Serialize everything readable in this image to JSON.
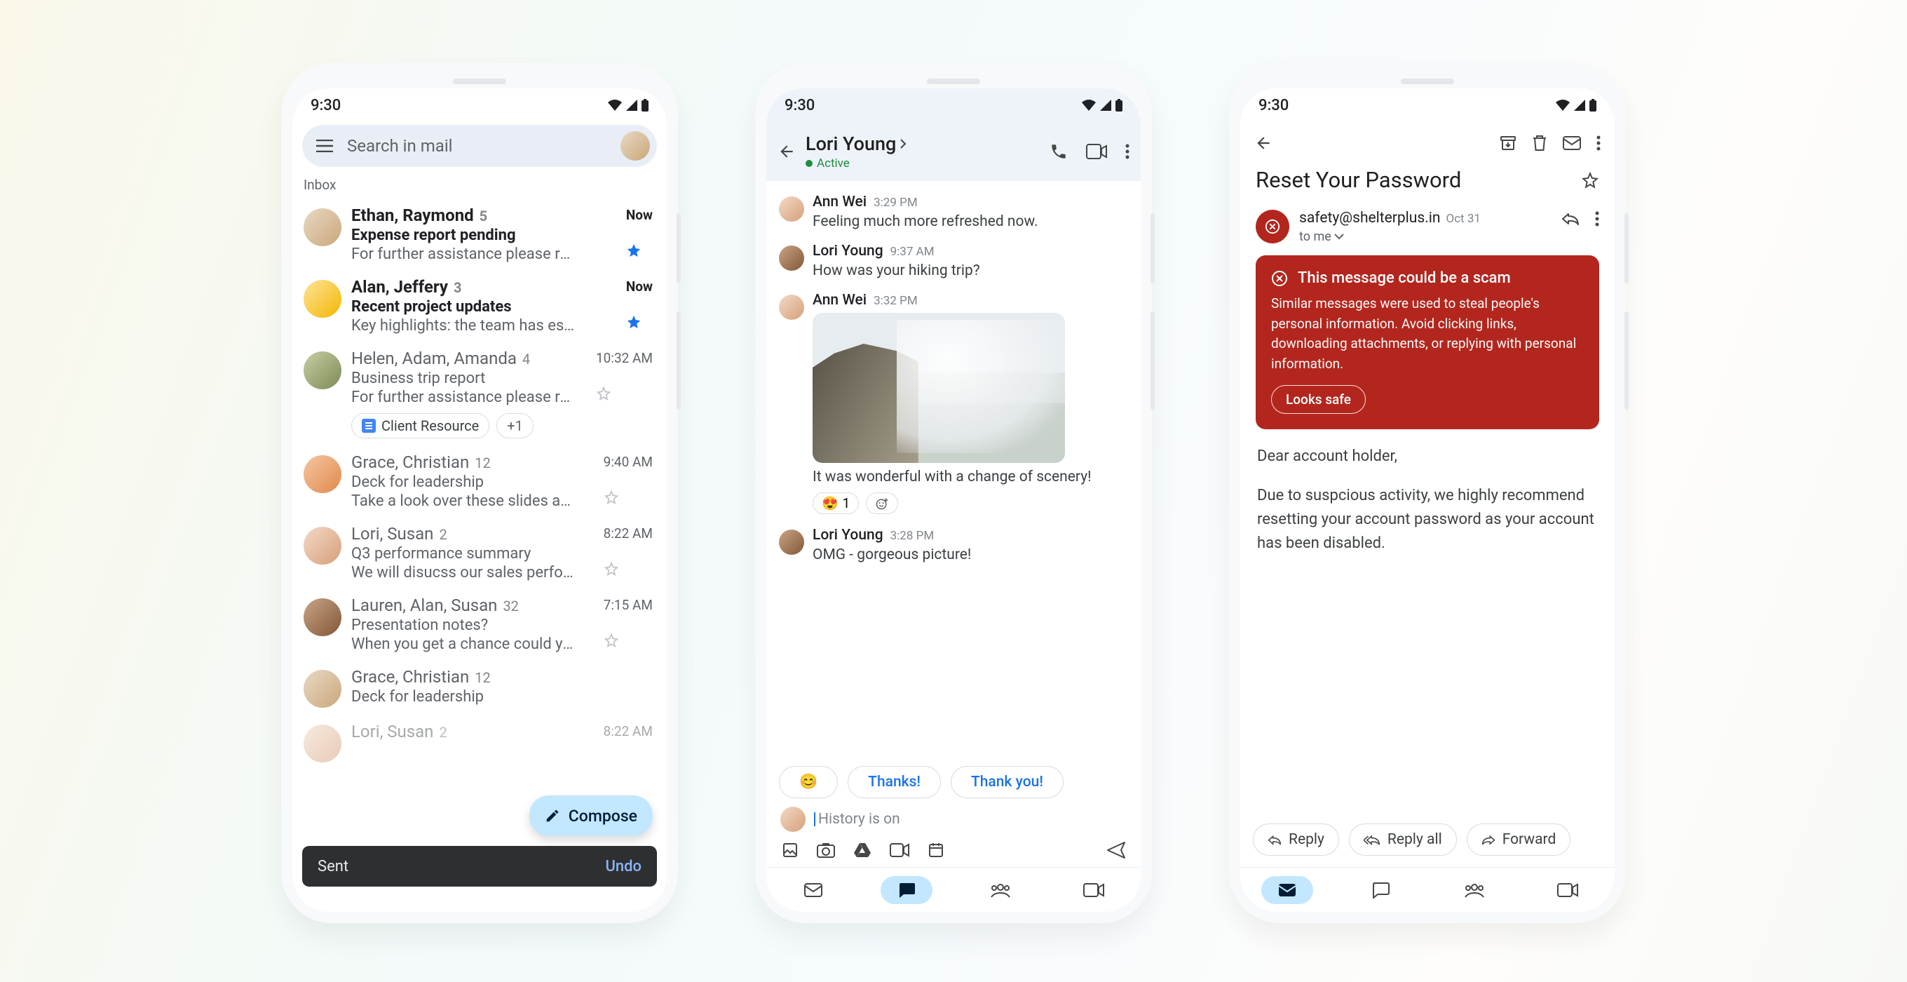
{
  "statusbar": {
    "time": "9:30"
  },
  "inbox": {
    "search_placeholder": "Search in mail",
    "section_label": "Inbox",
    "compose_label": "Compose",
    "toast": {
      "message": "Sent",
      "action": "Undo"
    },
    "rows": [
      {
        "senders": "Ethan, Raymond",
        "count": "5",
        "subject": "Expense report pending",
        "snippet": "For further assistance please reach …",
        "time": "Now",
        "unread": true,
        "starred": true
      },
      {
        "senders": "Alan, Jeffery",
        "count": "3",
        "subject": "Recent project updates",
        "snippet": "Key highlights: the team has establi…",
        "time": "Now",
        "unread": true,
        "starred": true
      },
      {
        "senders": "Helen, Adam, Amanda",
        "count": "4",
        "subject": "Business trip report",
        "snippet": "For further assistance please reach…",
        "time": "10:32 AM",
        "unread": false,
        "starred": false,
        "attachment": "Client Resource",
        "attachment_more": "+1"
      },
      {
        "senders": "Grace, Christian",
        "count": "12",
        "subject": "Deck for leadership",
        "snippet": "Take a look over these slides and le…",
        "time": "9:40 AM",
        "unread": false,
        "starred": false
      },
      {
        "senders": "Lori, Susan",
        "count": "2",
        "subject": "Q3 performance summary",
        "snippet": "We will disucss our sales performan…",
        "time": "8:22 AM",
        "unread": false,
        "starred": false
      },
      {
        "senders": "Lauren, Alan, Susan",
        "count": "32",
        "subject": "Presentation notes?",
        "snippet": "When you get a chance could you se…",
        "time": "7:15 AM",
        "unread": false,
        "starred": false
      },
      {
        "senders": "Grace, Christian",
        "count": "12",
        "subject": "Deck for leadership",
        "snippet": "",
        "time": "",
        "unread": false,
        "starred": false
      },
      {
        "senders": "Lori, Susan",
        "count": "2",
        "subject": "",
        "snippet": "",
        "time": "8:22 AM",
        "unread": false,
        "starred": false
      }
    ]
  },
  "chat": {
    "contact_name": "Lori Young",
    "status": "Active",
    "messages": [
      {
        "name": "Ann Wei",
        "time": "3:29 PM",
        "text": "Feeling much more refreshed now."
      },
      {
        "name": "Lori Young",
        "time": "9:37 AM",
        "text": "How was your hiking trip?"
      },
      {
        "name": "Ann Wei",
        "time": "3:32 PM",
        "text": "It was wonderful with a change of scenery!",
        "has_photo": true,
        "reaction": {
          "emoji": "😍",
          "count": "1"
        }
      },
      {
        "name": "Lori Young",
        "time": "3:28 PM",
        "text": "OMG - gorgeous picture!"
      }
    ],
    "suggestions": [
      "😊",
      "Thanks!",
      "Thank you!"
    ],
    "composer_placeholder": "History is on"
  },
  "detail": {
    "subject": "Reset Your Password",
    "from": "safety@shelterplus.in",
    "date": "Oct 31",
    "to_line": "to me",
    "warning": {
      "title": "This message could be a scam",
      "body": "Similar messages were used to steal people's personal information. Avoid clicking links, downloading attachments, or replying with personal information.",
      "button": "Looks safe"
    },
    "body_p1": "Dear account holder,",
    "body_p2": "Due to suspcious activity, we highly recommend resetting your account password as your account has been disabled.",
    "actions": {
      "reply": "Reply",
      "reply_all": "Reply all",
      "forward": "Forward"
    }
  }
}
